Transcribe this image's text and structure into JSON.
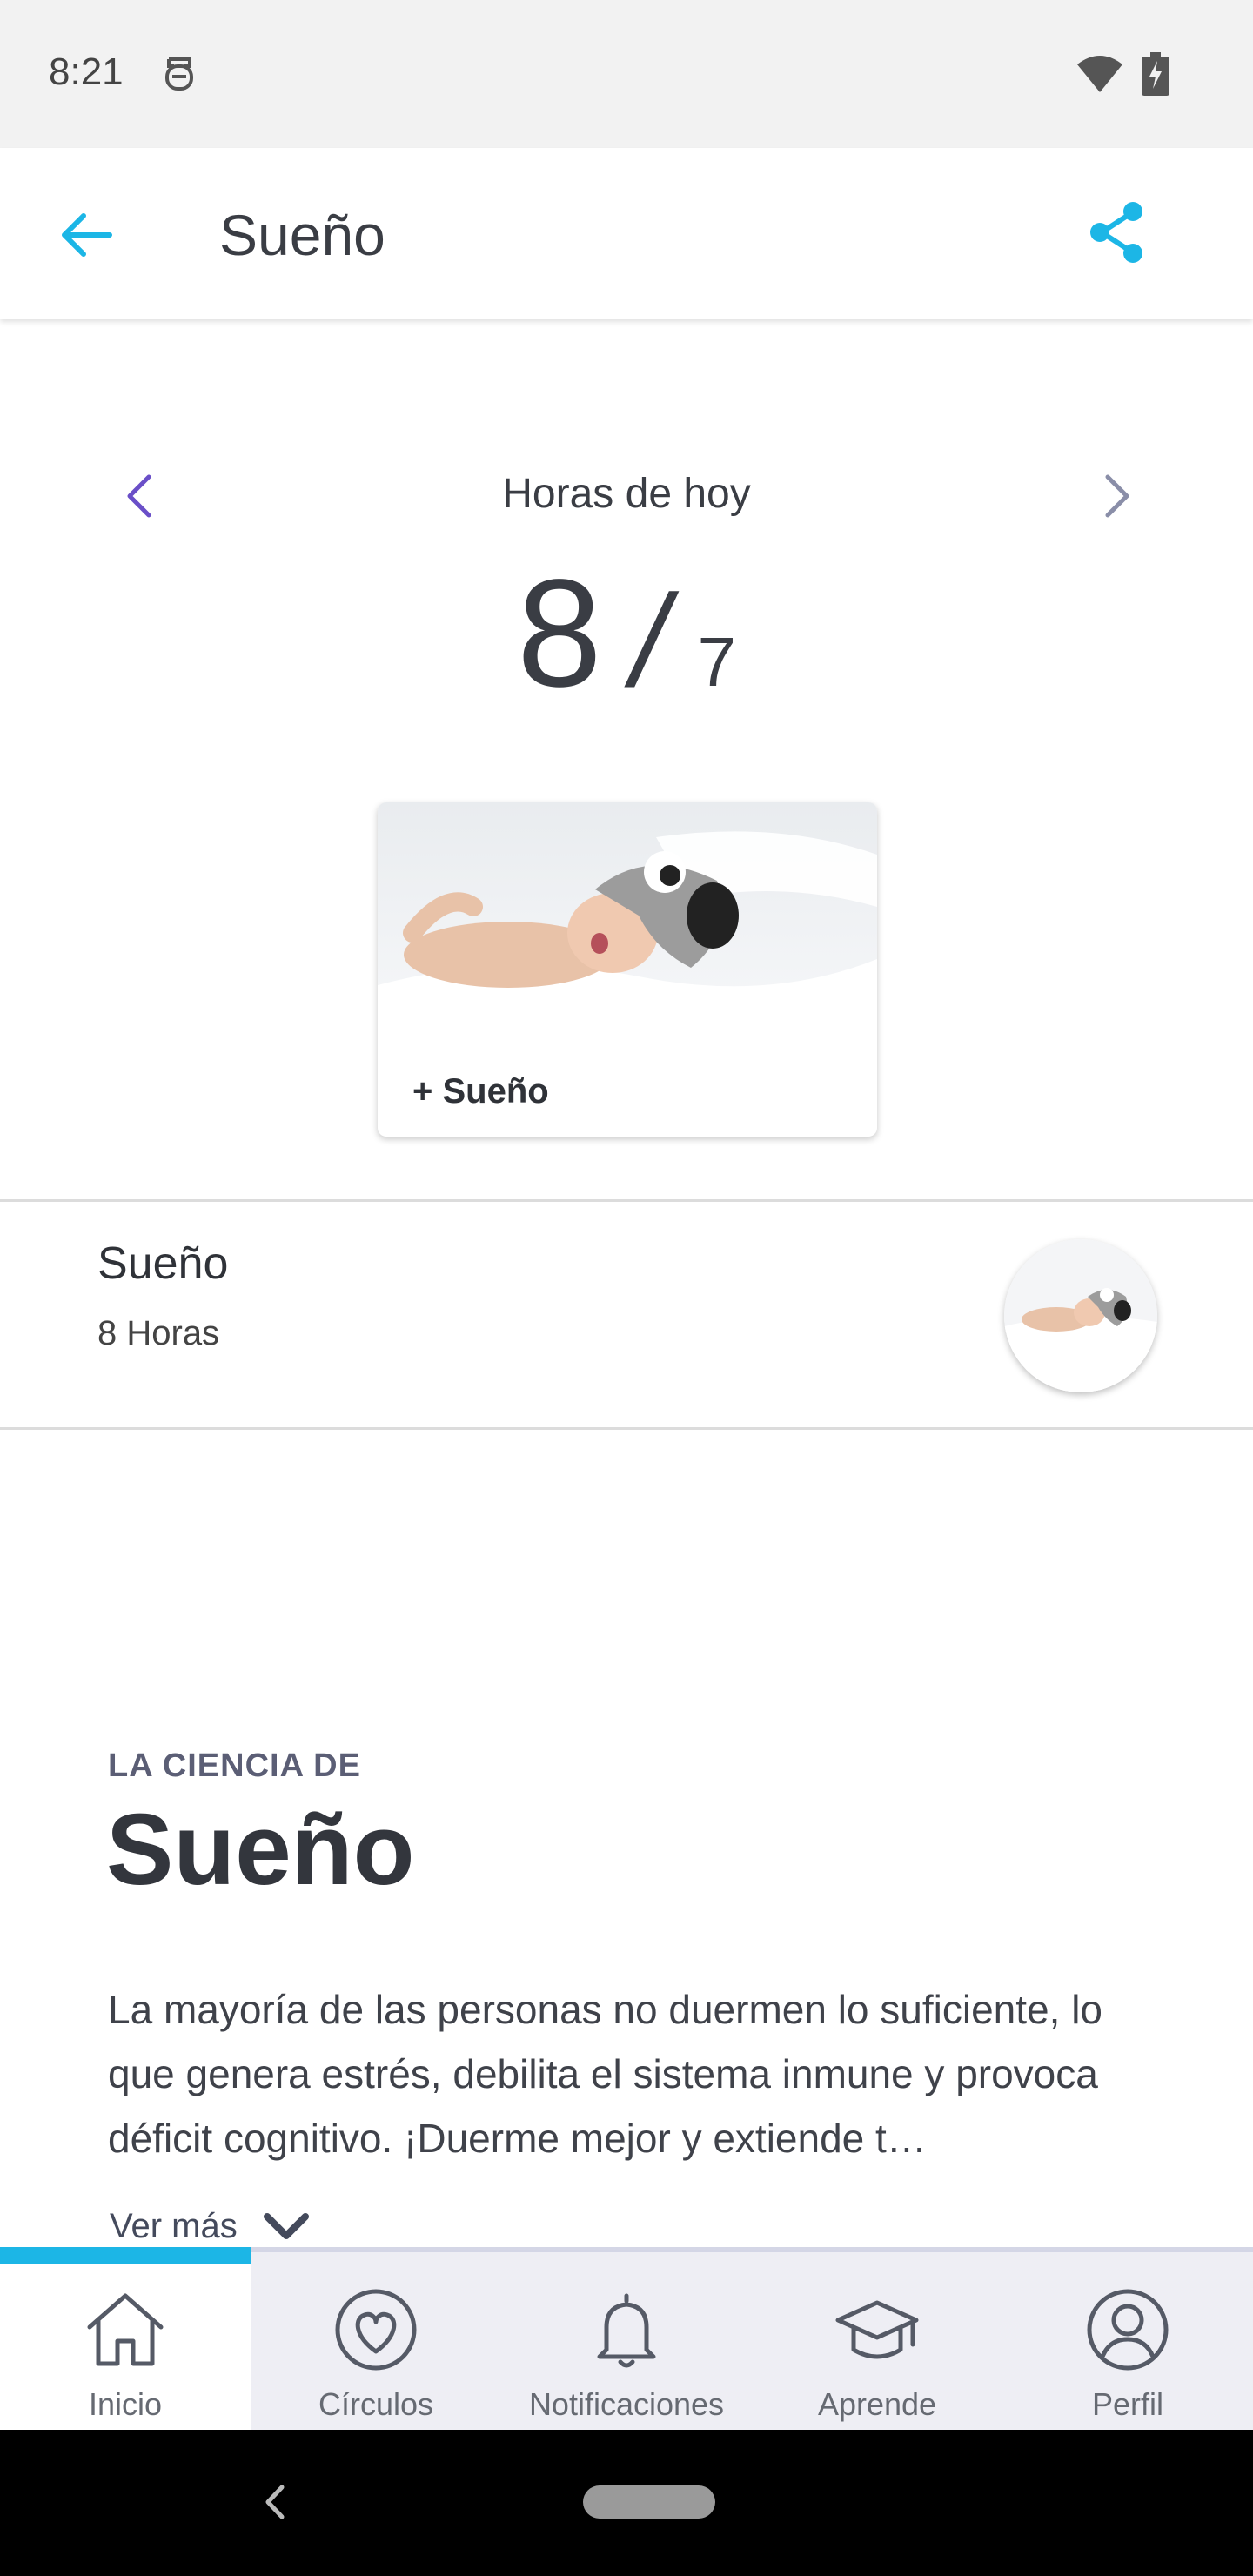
{
  "status_bar": {
    "time": "8:21"
  },
  "app_bar": {
    "title": "Sueño"
  },
  "hours": {
    "label": "Horas de hoy",
    "current": "8",
    "separator": "/",
    "goal": "7"
  },
  "add_card": {
    "label": "+ Sueño"
  },
  "entry": {
    "title": "Sueño",
    "subtitle": "8 Horas"
  },
  "science": {
    "kicker": "LA CIENCIA DE",
    "title": "Sueño",
    "body": "La mayoría de las personas no duermen lo suficiente, lo que genera estrés, debilita el sistema inmune y provoca déficit cognitivo. ¡Duerme mejor y extiende t…",
    "see_more": "Ver más"
  },
  "bottom_nav": {
    "items": [
      {
        "label": "Inicio",
        "icon": "home-icon",
        "active": true
      },
      {
        "label": "Círculos",
        "icon": "heart-circle-icon",
        "active": false
      },
      {
        "label": "Notificaciones",
        "icon": "bell-icon",
        "active": false
      },
      {
        "label": "Aprende",
        "icon": "graduation-cap-icon",
        "active": false
      },
      {
        "label": "Perfil",
        "icon": "profile-icon",
        "active": false
      }
    ]
  },
  "colors": {
    "accent": "#1cb6e6",
    "prev_arrow": "#6a4fc8",
    "next_arrow": "#8a8ea8",
    "text_dark": "#3a3d44"
  }
}
